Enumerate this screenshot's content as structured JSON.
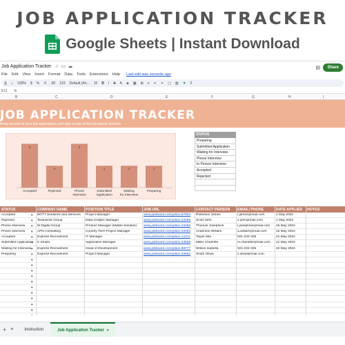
{
  "promo": {
    "title": "JOB APPLICATION TRACKER",
    "subtitle": "Google Sheets | Instant Download"
  },
  "window": {
    "doc_title": "Job Application Tracker",
    "share": "Share",
    "menu": [
      "File",
      "Edit",
      "View",
      "Insert",
      "Format",
      "Data",
      "Tools",
      "Extensions",
      "Help"
    ],
    "last_edit": "Last edit was seconds ago",
    "toolbar": {
      "zoom": "100%",
      "currency": "$",
      "percent": "%",
      "dec1": ".0",
      "dec2": ".00",
      "fmt": "123",
      "font": "Default (Ari...",
      "size": "10",
      "bold": "B",
      "italic": "I",
      "strike": "S",
      "color": "A"
    },
    "cell_ref": "E11"
  },
  "columns": [
    "B",
    "C",
    "D",
    "E",
    "F",
    "G",
    "H",
    "I"
  ],
  "sheet": {
    "title": "JOB APPLICATION TRACKER",
    "subtitle": "Keep records of your job applications and stay on top of the job search process"
  },
  "chart_data": {
    "type": "bar",
    "categories": [
      "Accepted",
      "Rejected",
      "Phone Interview",
      "Submitted Application",
      "Waiting for Interview",
      "Preparing"
    ],
    "values": [
      2,
      1,
      2,
      1,
      1,
      1
    ],
    "ylim": [
      0,
      2.2
    ],
    "color": "#d4907b"
  },
  "status_list": {
    "header": "STATUS",
    "items": [
      "Preparing",
      "Submitted Application",
      "Waiting for Interview",
      "Phone Interview",
      "In Person Interview",
      "Accepted",
      "Rejected",
      "",
      ""
    ]
  },
  "table": {
    "headers": [
      "STATUS",
      "COMPANY NAME",
      "POSITION TITLE",
      "JOB URL",
      "CONTACT PERSON",
      "EMAIL/ PHONE",
      "DATE APPLIED",
      "NOTES"
    ],
    "rows": [
      [
        "Accepted",
        "BOTT Solutions and Services",
        "Project Manager",
        "www.jobboard.com/jobid=87654",
        "Robinson James",
        "r.james@mail.com",
        "1 May 2022"
      ],
      [
        "Rejected",
        "Teamwork Group",
        "Data Analytic Manager",
        "www.jobboard.com/jobid=23456",
        "Scott John",
        "s.john@mail.com",
        "1 May 2022"
      ],
      [
        "Phone Interview",
        "M Digital Group",
        "Product Manager (Mobile Solution)",
        "www.jobboard.com/jobid=23466",
        "Thomas Josephine",
        "t.josephine@mail.com",
        "15 May 2022"
      ],
      [
        "Phone Interview",
        "APN Consulting",
        "Country Tech Project Manager",
        "www.jobboard.com/jobid=33453",
        "Anderson William",
        "a.william@mail.com",
        "15 May 2022"
      ],
      [
        "Accepted",
        "Express Recruitment",
        "IT Manager",
        "www.jobboard.com/jobid=12211",
        "Taylor Mia",
        "021-232-328",
        "21 May 2022"
      ],
      [
        "Submitted Application",
        "K Studio",
        "Application Manager",
        "www.jobboard.com/jobid=34556",
        "Miller Charlotte",
        "m.charlotte@mail.com",
        "21 May 2022"
      ],
      [
        "Waiting for Interview",
        "Express Recruitment",
        "Head of Development",
        "www.jobboard.com/jobid=98777",
        "Wilson Isabella",
        "021-232-325",
        "22 May 2022"
      ],
      [
        "Preparing",
        "Express Recruitment",
        "Project Manager",
        "www.jobboard.com/jobid=34552",
        "Smith Olivia",
        "s.olivia@mail.com",
        ""
      ],
      [
        "",
        "",
        "",
        "",
        "",
        "",
        ""
      ],
      [
        "",
        "",
        "",
        "",
        "",
        "",
        ""
      ],
      [
        "",
        "",
        "",
        "",
        "",
        "",
        ""
      ],
      [
        "",
        "",
        "",
        "",
        "",
        "",
        ""
      ],
      [
        "",
        "",
        "",
        "",
        "",
        "",
        ""
      ],
      [
        "",
        "",
        "",
        "",
        "",
        "",
        ""
      ],
      [
        "",
        "",
        "",
        "",
        "",
        "",
        ""
      ],
      [
        "",
        "",
        "",
        "",
        "",
        "",
        ""
      ],
      [
        "",
        "",
        "",
        "",
        "",
        "",
        ""
      ],
      [
        "",
        "",
        "",
        "",
        "",
        "",
        ""
      ],
      [
        "",
        "",
        "",
        "",
        "",
        "",
        ""
      ]
    ]
  },
  "tabs": {
    "items": [
      "Instruction",
      "Job Application Tracker"
    ],
    "active": 1
  }
}
